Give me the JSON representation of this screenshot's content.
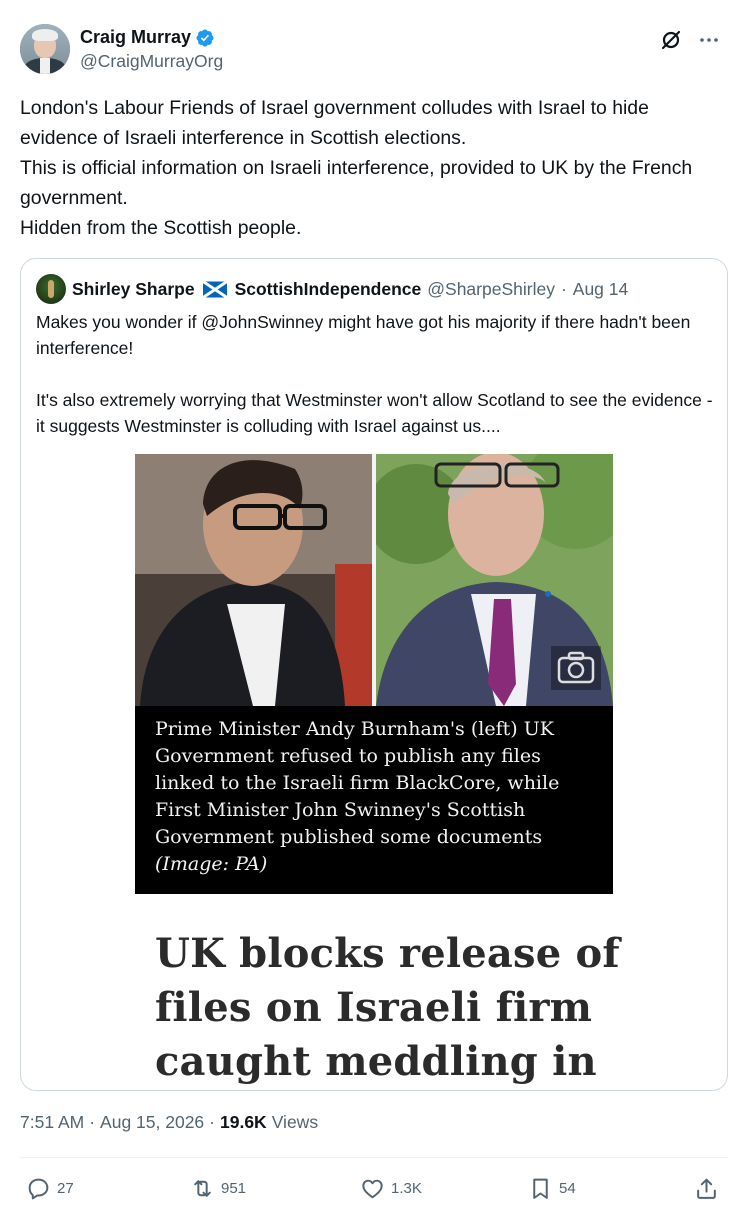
{
  "author": {
    "display_name": "Craig Murray",
    "handle": "@CraigMurrayOrg",
    "verified": true
  },
  "tweet": {
    "lines": [
      "London's Labour Friends of Israel government colludes with Israel to hide evidence of Israeli interference in Scottish elections.",
      "This is official information on Israeli interference, provided to UK by the French government.",
      "Hidden from the Scottish people."
    ]
  },
  "quote": {
    "name_part1": "Shirley Sharpe",
    "flag_icon": "scotland-flag-icon",
    "name_part2": "ScottishIndependence",
    "handle": "@SharpeShirley",
    "separator": "·",
    "date": "Aug 14",
    "paragraph1": "Makes you wonder if @JohnSwinney might have got his majority if there hadn't been interference!",
    "paragraph2": "It's also extremely worrying that Westminster won't allow Scotland to see the evidence  - it suggests Westminster is colluding with Israel against us....",
    "image_caption_lines": [
      "Prime Minister Andy Burnham's (left) UK",
      "Government refused to publish any files",
      "linked to the Israeli firm BlackCore, while",
      "First Minister John Swinney's Scottish",
      "Government published some documents"
    ],
    "image_credit": "(Image: PA)",
    "headline_lines": [
      "UK blocks release of",
      "files on Israeli firm",
      "caught meddling in"
    ]
  },
  "meta": {
    "time": "7:51 AM",
    "separator": "·",
    "date": "Aug 15, 2026",
    "views_count": "19.6K",
    "views_label": "Views"
  },
  "actions": {
    "replies": "27",
    "reposts": "951",
    "likes": "1.3K",
    "bookmarks": "54"
  },
  "colors": {
    "verified_blue": "#1d9bf0",
    "secondary_text": "#536471",
    "primary_text": "#0f1419",
    "border": "#cfd9de"
  }
}
